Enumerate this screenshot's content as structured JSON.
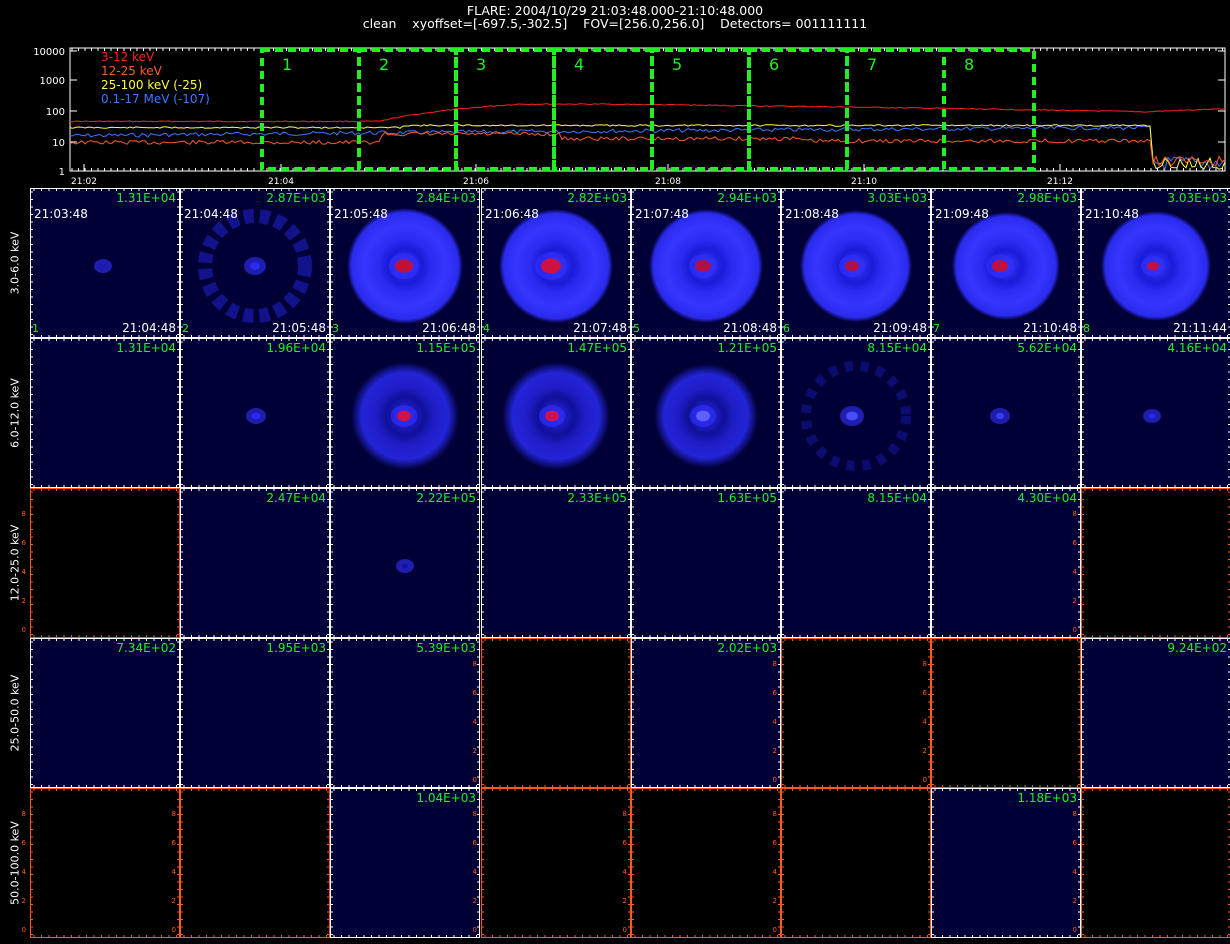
{
  "header": {
    "title": "FLARE: 2004/10/29 21:03:48.000-21:10:48.000",
    "subtitle": "clean    xyoffset=[-697.5,-302.5]    FOV=[256.0,256.0]    Detectors= 001111111"
  },
  "lightcurve": {
    "ytick_labels": [
      "10000",
      "1000",
      "100",
      "10",
      "1"
    ],
    "xtick_labels": [
      "21:02",
      "21:04",
      "21:06",
      "21:08",
      "21:10",
      "21:12"
    ],
    "legend": [
      {
        "label": "3-12 keV",
        "color": "#ff2020"
      },
      {
        "label": "12-25 keV",
        "color": "#ff5a1e"
      },
      {
        "label": "25-100 keV (-25)",
        "color": "#ffff40"
      },
      {
        "label": "0.1-17 MeV (-107)",
        "color": "#3c78ff"
      }
    ],
    "interval_labels": [
      "1",
      "2",
      "3",
      "4",
      "5",
      "6",
      "7",
      "8"
    ],
    "box_color": "#22ee22"
  },
  "grid": {
    "energy_bands": [
      "3.0-6.0 keV",
      "6.0-12.0 keV",
      "12.0-25.0 keV",
      "25.0-50.0 keV",
      "50.0-100.0 keV"
    ],
    "start_times": [
      "21:03:48",
      "21:04:48",
      "21:05:48",
      "21:06:48",
      "21:07:48",
      "21:08:48",
      "21:09:48",
      "21:10:48"
    ],
    "end_times": [
      "21:04:48",
      "21:05:48",
      "21:06:48",
      "21:07:48",
      "21:08:48",
      "21:09:48",
      "21:10:48",
      "21:11:44"
    ],
    "panel_numbers": [
      "1",
      "2",
      "3",
      "4",
      "5",
      "6",
      "7",
      "8"
    ],
    "max_values": [
      [
        "1.31E+04",
        "2.87E+03",
        "2.84E+03",
        "2.82E+03",
        "2.94E+03",
        "3.03E+03",
        "2.98E+03",
        "3.03E+03"
      ],
      [
        "1.31E+04",
        "1.96E+04",
        "1.15E+05",
        "1.47E+05",
        "1.21E+05",
        "8.15E+04",
        "5.62E+04",
        "4.16E+04"
      ],
      [
        "",
        "2.47E+04",
        "2.22E+05",
        "2.33E+05",
        "1.63E+05",
        "8.15E+04",
        "4.30E+04",
        ""
      ],
      [
        "7.34E+02",
        "1.95E+03",
        "5.39E+03",
        "",
        "2.02E+03",
        "",
        "",
        "9.24E+02"
      ],
      [
        "",
        "",
        "1.04E+03",
        "",
        "",
        "",
        "1.18E+03",
        ""
      ]
    ],
    "empty_tick_labels": [
      "0",
      "2",
      "4",
      "6",
      "8"
    ],
    "colors": {
      "value_text": "#22ee22",
      "empty_axes": "#ff5a1e",
      "panel_bg": "#000036"
    }
  }
}
